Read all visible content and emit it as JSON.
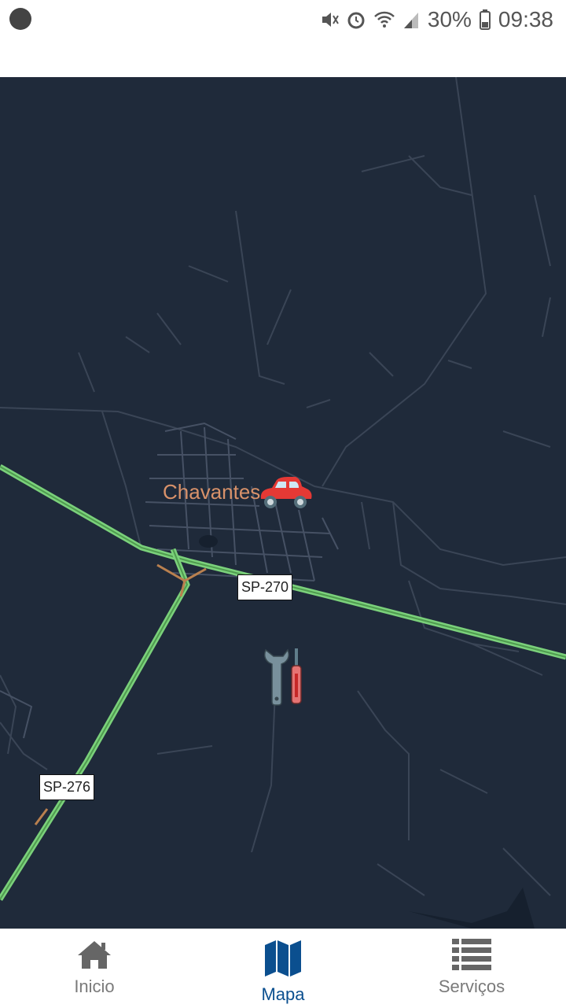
{
  "status_bar": {
    "battery": "30%",
    "time": "09:38"
  },
  "map": {
    "city_label": "Chavantes",
    "road_labels": [
      "SP-270",
      "SP-276"
    ],
    "markers": {
      "car": "car-icon",
      "tools": "wrench-screwdriver-icon"
    },
    "colors": {
      "background": "#1f2a3a",
      "highway": "#7bd17b",
      "roads": "#3a4556",
      "city_label": "#d9926a"
    }
  },
  "bottom_nav": {
    "items": [
      {
        "label": "Inicio",
        "icon": "home-icon"
      },
      {
        "label": "Mapa",
        "icon": "map-icon",
        "active": true
      },
      {
        "label": "Serviços",
        "icon": "list-icon"
      }
    ]
  }
}
